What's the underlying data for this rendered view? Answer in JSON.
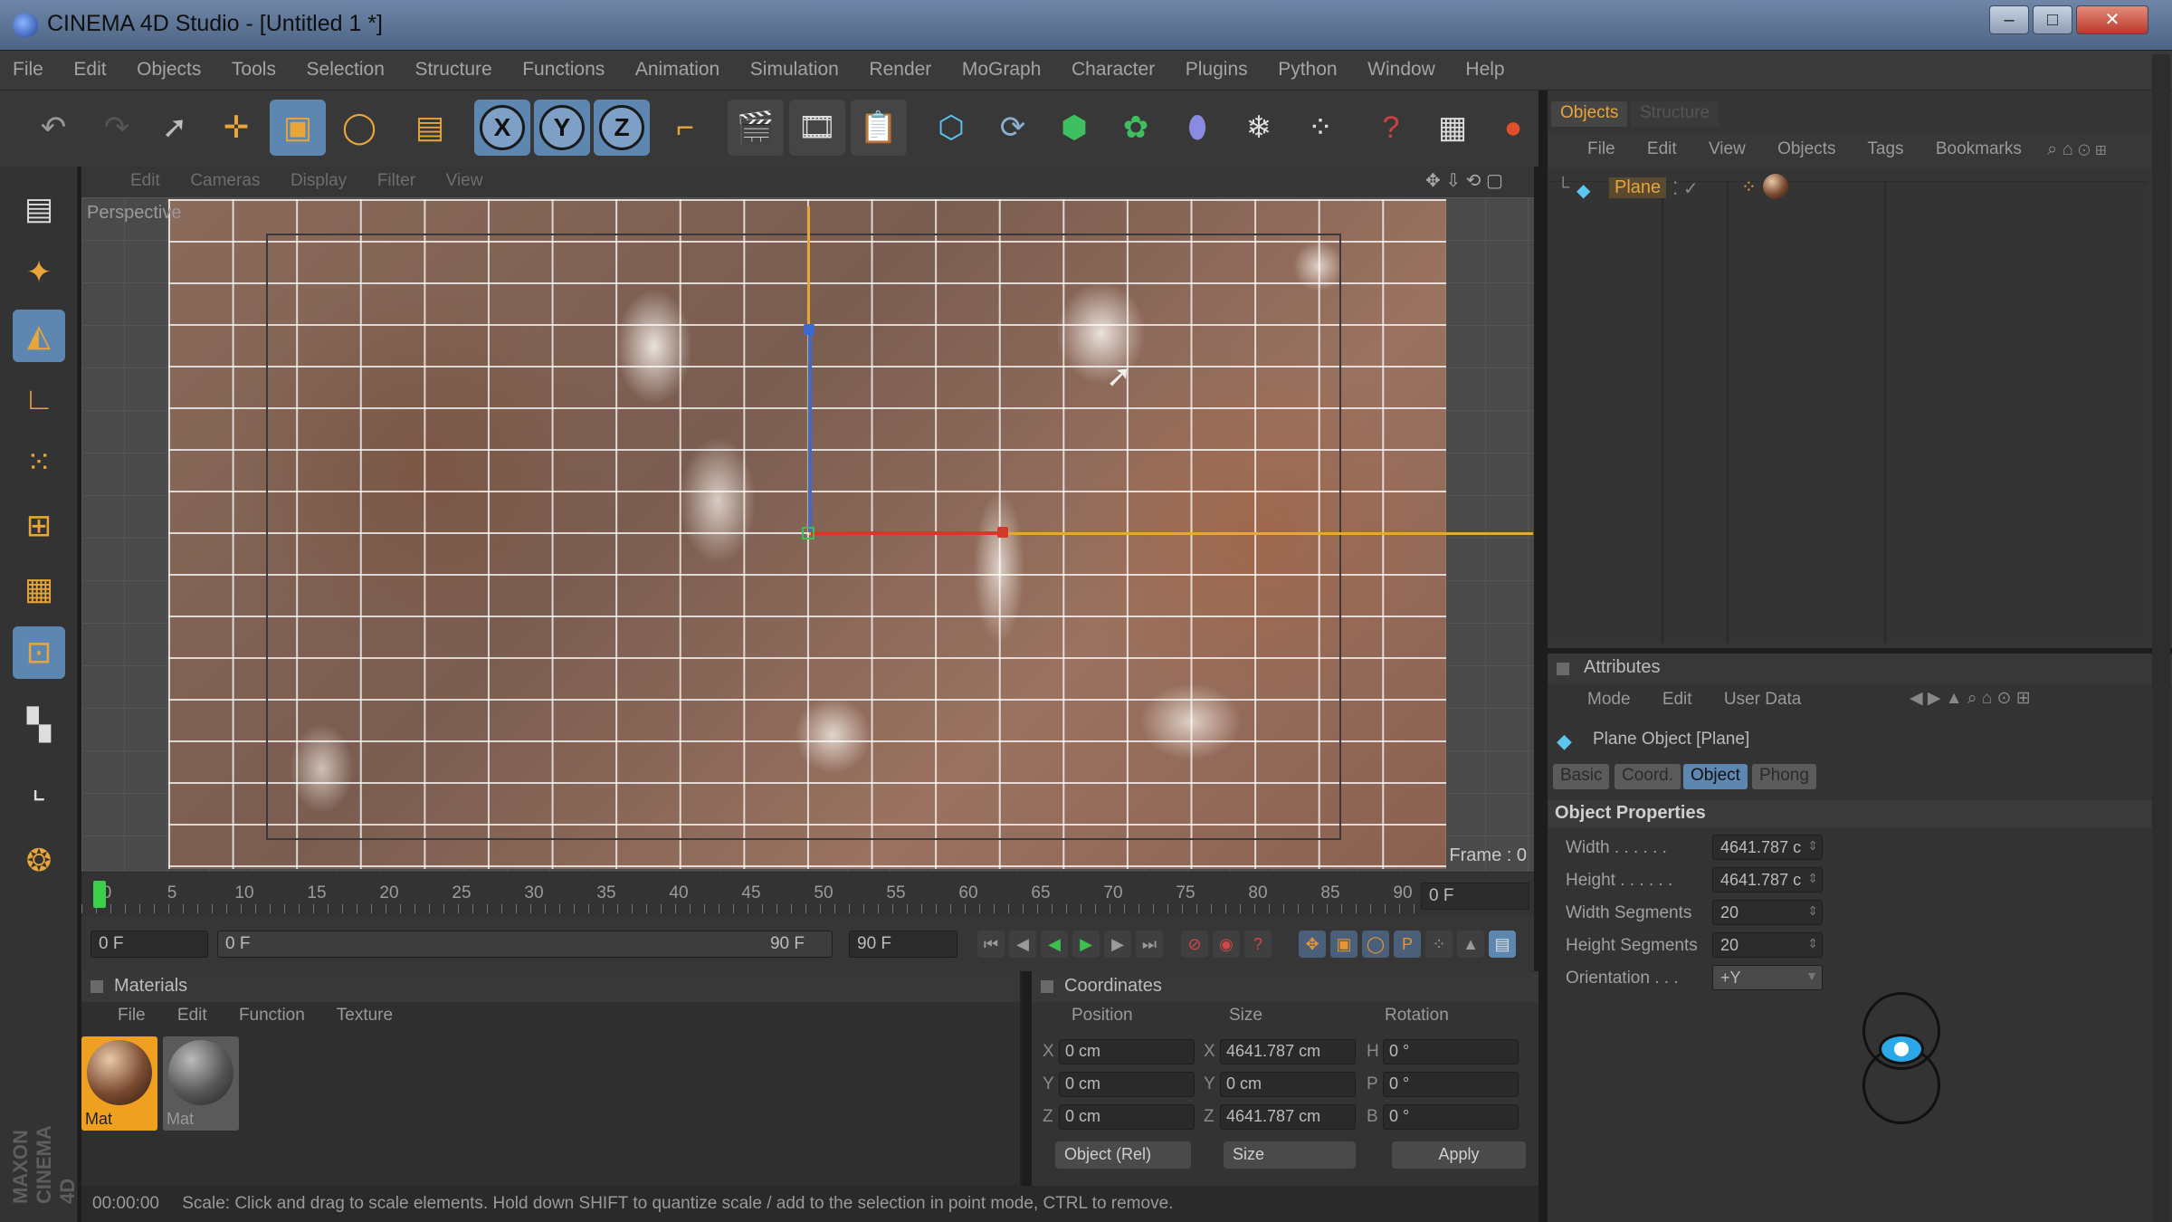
{
  "window": {
    "title": "CINEMA 4D Studio - [Untitled 1 *]"
  },
  "menu": [
    "File",
    "Edit",
    "Objects",
    "Tools",
    "Selection",
    "Structure",
    "Functions",
    "Animation",
    "Simulation",
    "Render",
    "MoGraph",
    "Character",
    "Plugins",
    "Python",
    "Window",
    "Help"
  ],
  "toolbar": {
    "undo_icon": "undo-icon",
    "redo_icon": "redo-icon",
    "select_icon": "select-icon",
    "move_icon": "move-icon",
    "scale_icon": "scale-icon",
    "rotate_icon": "rotate-icon",
    "x": "X",
    "y": "Y",
    "z": "Z"
  },
  "viewport": {
    "menu": [
      "Edit",
      "Cameras",
      "Display",
      "Filter",
      "View"
    ],
    "label": "Perspective",
    "frame": "Frame : 0"
  },
  "timeline": {
    "ticks": [
      "0",
      "5",
      "10",
      "15",
      "20",
      "25",
      "30",
      "35",
      "40",
      "45",
      "50",
      "55",
      "60",
      "65",
      "70",
      "75",
      "80",
      "85",
      "90"
    ],
    "current": "0 F",
    "start": "0 F",
    "range_start": "0 F",
    "range_end": "90 F",
    "end": "90 F"
  },
  "materials": {
    "title": "Materials",
    "menu": [
      "File",
      "Edit",
      "Function",
      "Texture"
    ],
    "items": [
      {
        "label": "Mat",
        "color": "#f0a020"
      },
      {
        "label": "Mat",
        "color": "#6a6a6a"
      }
    ]
  },
  "coordinates": {
    "title": "Coordinates",
    "headers": [
      "Position",
      "Size",
      "Rotation"
    ],
    "rows": [
      {
        "axis": "X",
        "pos": "0 cm",
        "size_axis": "X",
        "size": "4641.787 cm",
        "rot_axis": "H",
        "rot": "0 °"
      },
      {
        "axis": "Y",
        "pos": "0 cm",
        "size_axis": "Y",
        "size": "0 cm",
        "rot_axis": "P",
        "rot": "0 °"
      },
      {
        "axis": "Z",
        "pos": "0 cm",
        "size_axis": "Z",
        "size": "4641.787 cm",
        "rot_axis": "B",
        "rot": "0 °"
      }
    ],
    "mode": "Object (Rel)",
    "size_mode": "Size",
    "apply": "Apply"
  },
  "status": {
    "time": "00:00:00",
    "message": "Scale: Click and drag to scale elements. Hold down SHIFT to quantize scale / add to the selection in point mode, CTRL to remove."
  },
  "objects": {
    "tabs": [
      "Objects",
      "Structure"
    ],
    "menu": [
      "File",
      "Edit",
      "View",
      "Objects",
      "Tags",
      "Bookmarks"
    ],
    "items": [
      {
        "name": "Plane"
      }
    ]
  },
  "attributes": {
    "title": "Attributes",
    "menu": [
      "Mode",
      "Edit",
      "User Data"
    ],
    "object_label": "Plane Object [Plane]",
    "tabs": [
      "Basic",
      "Coord.",
      "Object",
      "Phong"
    ],
    "active_tab": "Object",
    "section": "Object Properties",
    "fields": [
      {
        "label": "Width . . . . . .",
        "value": "4641.787 c"
      },
      {
        "label": "Height . . . . . .",
        "value": "4641.787 c"
      },
      {
        "label": "Width Segments",
        "value": "20"
      },
      {
        "label": "Height Segments",
        "value": "20"
      },
      {
        "label": "Orientation . . .",
        "value": "+Y"
      }
    ]
  },
  "brand": "MAXON CINEMA 4D",
  "colors": {
    "accent": "#5d86b0",
    "tool_orange": "#e8a53a",
    "axis_x": "#d43a2a",
    "axis_y": "#3a6ad4",
    "axis_z": "#3cc050"
  }
}
